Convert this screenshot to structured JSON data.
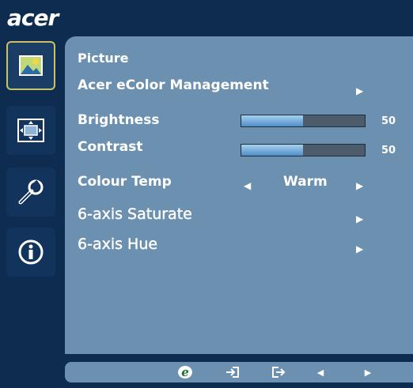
{
  "brand": {
    "logo_text": "acer"
  },
  "sidebar": {
    "items": [
      {
        "name": "picture",
        "icon": "picture-icon",
        "active": true
      },
      {
        "name": "osd",
        "icon": "screen-position-icon",
        "active": false
      },
      {
        "name": "settings",
        "icon": "settings-wrench-icon",
        "active": false
      },
      {
        "name": "information",
        "icon": "information-icon",
        "active": false
      }
    ]
  },
  "menu": {
    "title": "Picture",
    "ecolor_label": "Acer eColor Management",
    "brightness": {
      "label": "Brightness",
      "value": "50",
      "level": 50
    },
    "contrast": {
      "label": "Contrast",
      "value": "50",
      "level": 50
    },
    "colour_temp": {
      "label": "Colour Temp",
      "value": "Warm"
    },
    "saturate_label": "6-axis Saturate",
    "hue_label": "6-axis Hue"
  },
  "bottom_bar": {
    "icons": [
      "empowering-e-icon",
      "menu-enter-icon",
      "menu-exit-icon",
      "left-arrow-icon",
      "right-arrow-icon"
    ]
  },
  "colors": {
    "panel": "#6c90af",
    "background": "#0e2b50",
    "active_border": "#c9c267",
    "slider_fill": "#6aa7d8",
    "slider_track": "#4c5c6a"
  }
}
